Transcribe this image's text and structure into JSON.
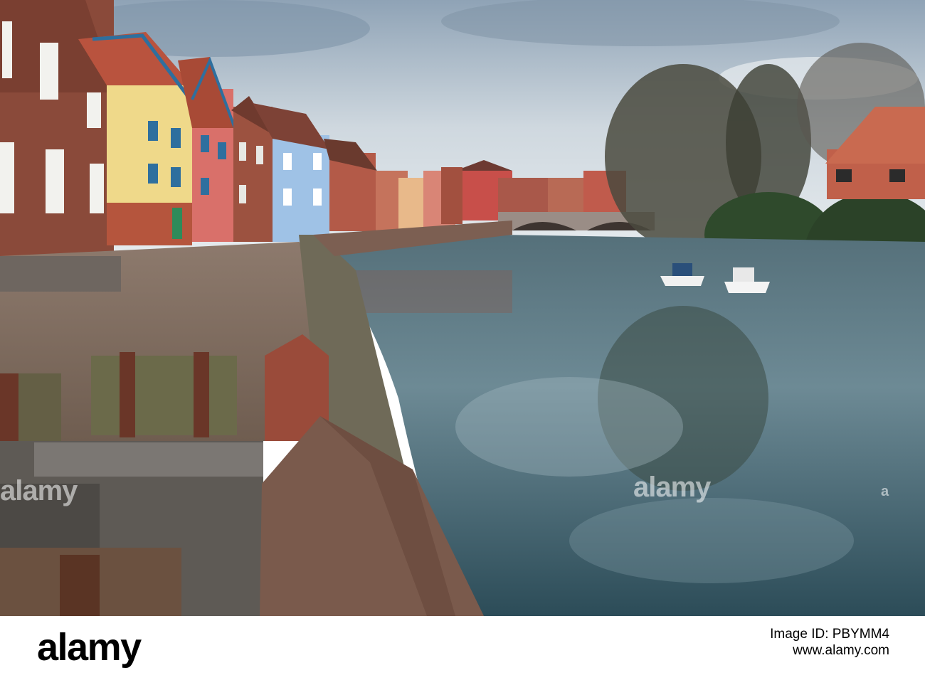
{
  "watermark": {
    "left_text": "alamy",
    "center_text": "alamy",
    "right_text": "a"
  },
  "footer": {
    "brand": "alamy",
    "image_id_label": "Image ID: PBYMM4",
    "site": "www.alamy.com"
  },
  "colors": {
    "sky": "#c9d3dc",
    "water": "#3f6270",
    "brick": "#8a4a3a",
    "yellow_house": "#efd98a",
    "pink_house": "#d9706a",
    "blue_house": "#9fc2e6"
  }
}
